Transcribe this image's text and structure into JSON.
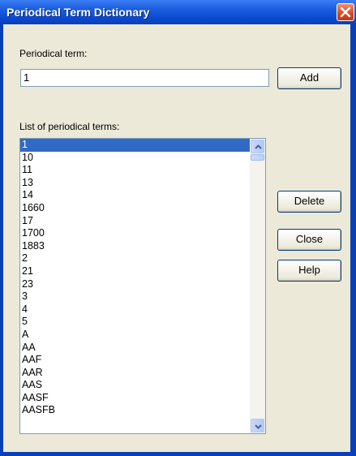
{
  "window": {
    "title": "Periodical Term Dictionary"
  },
  "term_field": {
    "label": "Periodical term:",
    "value": "1"
  },
  "buttons": {
    "add": "Add",
    "delete": "Delete",
    "close": "Close",
    "help": "Help"
  },
  "list": {
    "label": "List of periodical terms:",
    "items": [
      "1",
      "10",
      "11",
      "13",
      "14",
      "1660",
      "17",
      "1700",
      "1883",
      "2",
      "21",
      "23",
      "3",
      "4",
      "5",
      "A",
      "AA",
      "AAF",
      "AAR",
      "AAS",
      "AASF",
      "AASFB"
    ],
    "selected_index": 0
  },
  "colors": {
    "titlebar": "#0a4ad0",
    "selection": "#316ac5",
    "dialog_bg": "#ece9d8",
    "close_button": "#d8481e"
  },
  "icons": {
    "close": "close-x-icon",
    "scroll_up": "chevron-up-icon",
    "scroll_down": "chevron-down-icon"
  }
}
